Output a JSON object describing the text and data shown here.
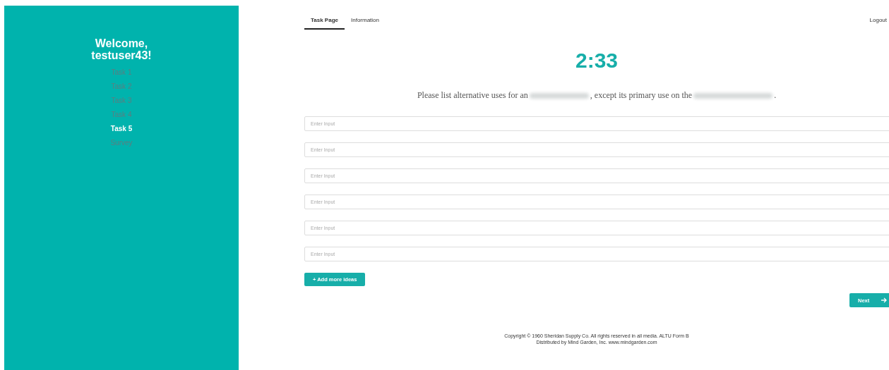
{
  "sidebar": {
    "greeting": "Welcome,",
    "username": "testuser43!",
    "items": [
      {
        "label": "Task 1",
        "selected": false
      },
      {
        "label": "Task 2",
        "selected": false
      },
      {
        "label": "Task 3",
        "selected": false
      },
      {
        "label": "Task 4",
        "selected": false
      },
      {
        "label": "Task 5",
        "selected": true
      },
      {
        "label": "Survey",
        "selected": false
      }
    ]
  },
  "tabs": [
    {
      "label": "Task Page",
      "selected": true
    },
    {
      "label": "Information",
      "selected": false
    }
  ],
  "logout": "Logout",
  "timer": "2:33",
  "prompt": {
    "before": "Please list alternative uses for an",
    "middle": ", except its primary use on the",
    "after": "."
  },
  "inputs": [
    {
      "placeholder": "Enter Input"
    },
    {
      "placeholder": "Enter Input"
    },
    {
      "placeholder": "Enter Input"
    },
    {
      "placeholder": "Enter Input"
    },
    {
      "placeholder": "Enter Input"
    },
    {
      "placeholder": "Enter Input"
    }
  ],
  "add_button": "+ Add more ideas",
  "next_button": "Next",
  "footer": [
    "Copyright © 1960 Sheridan Supply Co. All rights reserved in all media. ALTU Form B",
    "Distributed by Mind Garden, Inc. www.mindgarden.com"
  ]
}
